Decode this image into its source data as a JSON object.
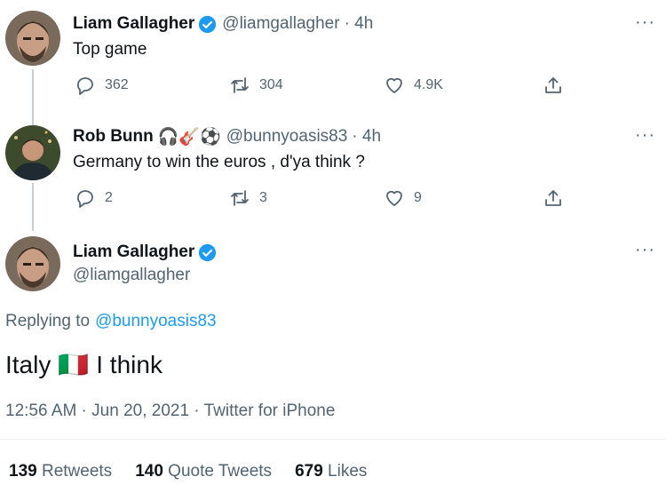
{
  "tweet1": {
    "name": "Liam Gallagher",
    "handle": "@liamgallagher",
    "time": "· 4h",
    "text": "Top game",
    "replies": "362",
    "retweets": "304",
    "likes": "4.9K"
  },
  "tweet2": {
    "name": "Rob Bunn",
    "emoji": "🎧🎸⚽",
    "handle": "@bunnyoasis83",
    "time": "· 4h",
    "text": "Germany to win the euros , d'ya think ?",
    "replies": "2",
    "retweets": "3",
    "likes": "9"
  },
  "main": {
    "name": "Liam Gallagher",
    "handle": "@liamgallagher",
    "replying_prefix": "Replying to",
    "replying_handle": "@bunnyoasis83",
    "text_before": "Italy",
    "flag": "🇮🇹",
    "text_after": "I think",
    "meta": "12:56 AM · Jun 20, 2021 · Twitter for iPhone",
    "retweets_count": "139",
    "retweets_label": "Retweets",
    "quotes_count": "140",
    "quotes_label": "Quote Tweets",
    "likes_count": "679",
    "likes_label": "Likes"
  },
  "more_label": "···",
  "colors": {
    "link": "#1d9bf0",
    "secondary": "#536471",
    "thread_line": "#c4cfd6"
  }
}
